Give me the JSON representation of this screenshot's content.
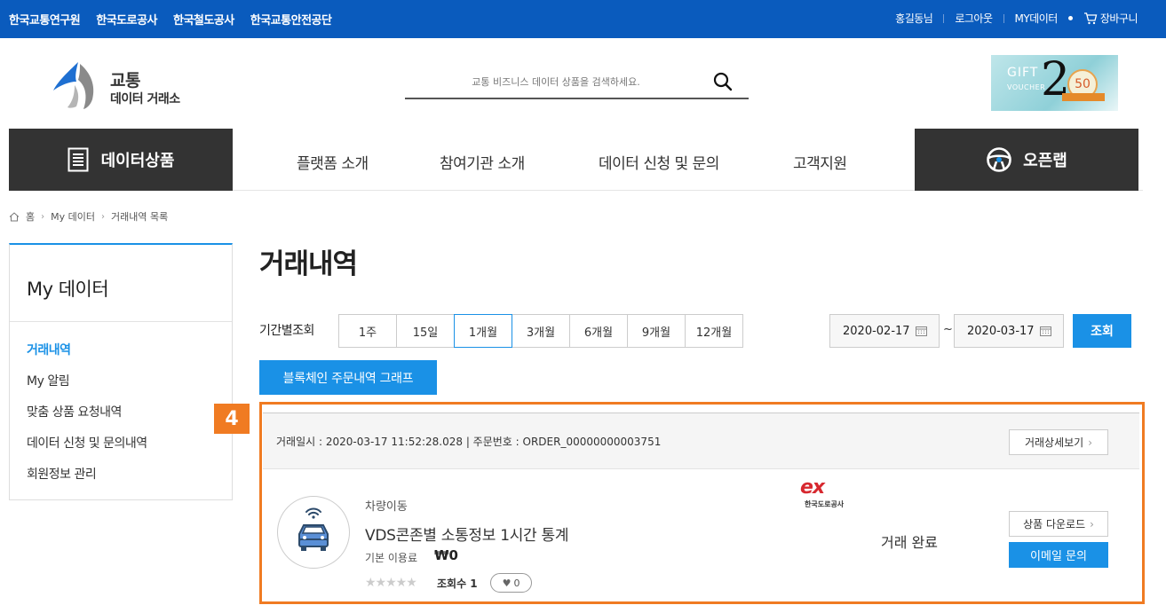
{
  "topbar": {
    "left_links": [
      "한국교통연구원",
      "한국도로공사",
      "한국철도공사",
      "한국교통안전공단"
    ],
    "user_greeting": "홍길동님",
    "logout": "로그아웃",
    "my_data": "MY데이터",
    "cart": "장바구니"
  },
  "logo": {
    "line1": "교통",
    "line2": "데이터 거래소"
  },
  "search": {
    "placeholder": "교통 비즈니스 데이터 상품을 검색하세요."
  },
  "voucher": {
    "gift": "GIFT",
    "voucher": "VOUCHER",
    "number": "2",
    "badge": "50"
  },
  "nav": {
    "category": "데이터상품",
    "menus": [
      "플랫폼 소개",
      "참여기관 소개",
      "데이터 신청 및 문의",
      "고객지원"
    ],
    "openlab": "오픈랩"
  },
  "breadcrumb": {
    "home": "홈",
    "level1": "My 데이터",
    "level2": "거래내역 목록"
  },
  "sidebar": {
    "title": "My 데이터",
    "items": [
      "거래내역",
      "My 알림",
      "맞춤 상품 요청내역",
      "데이터 신청 및 문의내역",
      "회원정보 관리"
    ],
    "active_index": 0
  },
  "main": {
    "title": "거래내역",
    "period_label": "기간별조회",
    "periods": [
      "1주",
      "15일",
      "1개월",
      "3개월",
      "6개월",
      "9개월",
      "12개월"
    ],
    "selected_period": "1개월",
    "date_from": "2020-02-17",
    "date_sep": "~",
    "date_to": "2020-03-17",
    "search_button": "조회",
    "graph_button": "블록체인 주문내역 그래프"
  },
  "step_badge": "4",
  "order": {
    "info": "거래일시 : 2020-03-17 11:52:28.028 | 주문번호 : ORDER_00000000003751",
    "detail_button": "거래상세보기",
    "category": "차량이동",
    "name": "VDS콘존별 소통정보 1시간 통계",
    "fee_label": "기본 이용료",
    "fee": "₩0",
    "rating_stars": 0,
    "views_label": "조회수 1",
    "likes": "0",
    "org_logo": "ex",
    "org_name": "한국도로공사",
    "status": "거래 완료",
    "download_button": "상품 다운로드",
    "email_button": "이메일 문의"
  },
  "colors": {
    "topbar": "#0a5bbd",
    "accent": "#1a91e6",
    "highlight": "#f07b22",
    "nav_dark": "#333333"
  }
}
